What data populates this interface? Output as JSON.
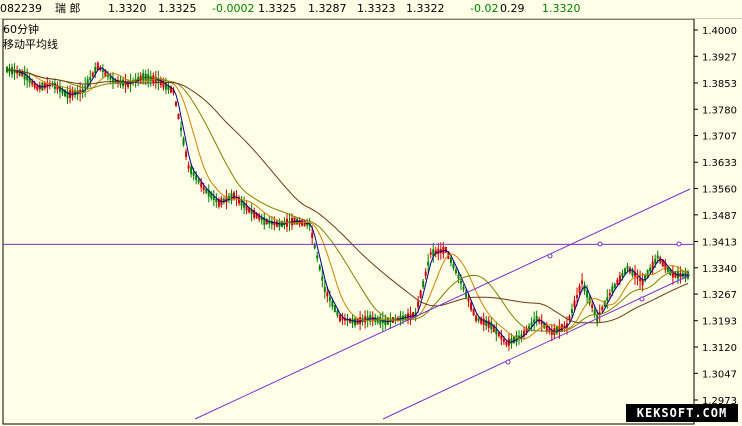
{
  "header": {
    "code": "082239",
    "name": "瑞 郎",
    "open": "1.3320",
    "high": "1.3325",
    "change": "-0.0002",
    "v1": "1.3325",
    "v2": "1.3287",
    "v3": "1.3323",
    "v4": "1.3322",
    "v5": "-0.02",
    "v6": "0.29",
    "v7": "1.3320"
  },
  "labels": {
    "period": "60分钟",
    "indicator": "移动平均线"
  },
  "watermark": "KEKSOFT.COM",
  "colors": {
    "background": "#ffffe8",
    "candle_up": "#d00000",
    "candle_down": "#008000",
    "ma_short": "#00008b",
    "ma_mid": "#d08000",
    "ma_long": "#808000",
    "ma_longest": "#6b3a1a",
    "trendline": "#7a2fd0"
  },
  "chart_data": {
    "type": "line",
    "title": "",
    "ylim": [
      2.97,
      1.4
    ],
    "yticks": [
      "1.4000",
      "1.3927",
      "1.3853",
      "1.3780",
      "1.3707",
      "1.3633",
      "1.3560",
      "1.3487",
      "1.3413",
      "1.3340",
      "1.3267",
      "1.3193",
      "1.3120",
      "1.3047",
      "1.2973"
    ],
    "grid": false,
    "series": [
      {
        "name": "",
        "values": [
          1.389,
          1.388,
          1.384,
          1.385,
          1.382,
          1.383,
          1.39,
          1.386,
          1.385,
          1.387,
          1.386,
          1.383,
          1.362,
          1.356,
          1.352,
          1.354,
          1.35,
          1.347,
          1.346,
          1.347,
          1.346,
          1.328,
          1.32,
          1.319,
          1.32,
          1.319,
          1.32,
          1.321,
          1.338,
          1.339,
          1.33,
          1.32,
          1.318,
          1.313,
          1.315,
          1.32,
          1.316,
          1.318,
          1.33,
          1.32,
          1.328,
          1.334,
          1.33,
          1.337,
          1.332,
          1.332
        ]
      }
    ]
  }
}
